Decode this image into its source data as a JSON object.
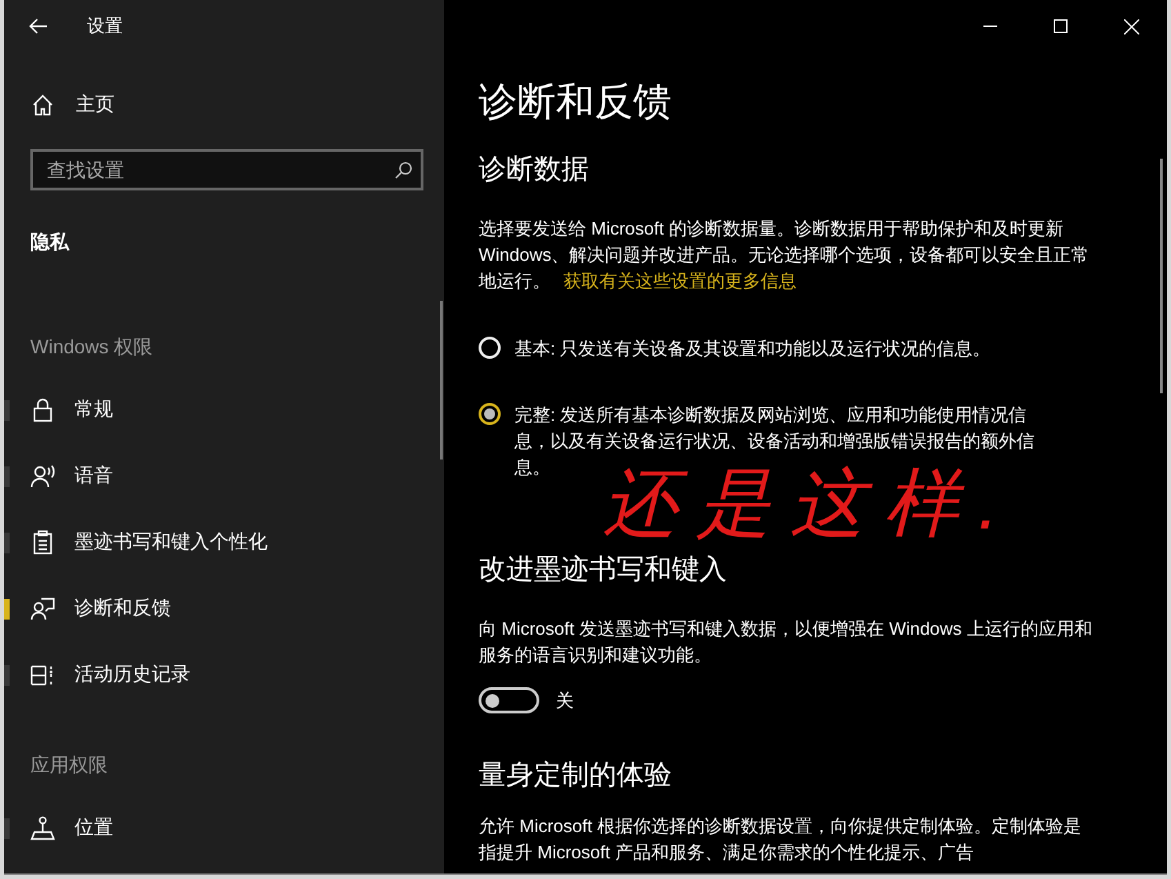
{
  "window": {
    "title": "设置"
  },
  "sidebar": {
    "home": "主页",
    "search": {
      "placeholder": "查找设置"
    },
    "section": "隐私",
    "groups": [
      {
        "heading": "Windows 权限",
        "items": [
          {
            "label": "常规",
            "kind": "lock",
            "selected": false
          },
          {
            "label": "语音",
            "kind": "speech",
            "selected": false
          },
          {
            "label": "墨迹书写和键入个性化",
            "kind": "clipboard",
            "selected": false
          },
          {
            "label": "诊断和反馈",
            "kind": "feedback",
            "selected": true
          },
          {
            "label": "活动历史记录",
            "kind": "timeline",
            "selected": false
          }
        ]
      },
      {
        "heading": "应用权限",
        "items": [
          {
            "label": "位置",
            "kind": "location",
            "selected": false
          }
        ]
      }
    ]
  },
  "main": {
    "title": "诊断和反馈",
    "sections": [
      {
        "kind": "radio",
        "heading": "诊断数据",
        "description": "选择要发送给 Microsoft 的诊断数据量。诊断数据用于帮助保护和及时更新 Windows、解决问题并改进产品。无论选择哪个选项，设备都可以安全且正常地运行。",
        "link": "获取有关这些设置的更多信息",
        "options": [
          {
            "label": "基本: 只发送有关设备及其设置和功能以及运行状况的信息。",
            "selected": false
          },
          {
            "label": "完整: 发送所有基本诊断数据及网站浏览、应用和功能使用情况信息，以及有关设备运行状况、设备活动和增强版错误报告的额外信息。",
            "selected": true
          }
        ]
      },
      {
        "kind": "toggle",
        "heading": "改进墨迹书写和键入",
        "description": "向 Microsoft 发送墨迹书写和键入数据，以便增强在 Windows 上运行的应用和服务的语言识别和建议功能。",
        "toggle": {
          "on": false,
          "label": "关"
        }
      },
      {
        "kind": "text",
        "heading": "量身定制的体验",
        "description": "允许 Microsoft 根据你选择的诊断数据设置，向你提供定制体验。定制体验是指提升 Microsoft 产品和服务、满足你需求的个性化提示、广告"
      }
    ]
  },
  "annotation": "还是这样."
}
